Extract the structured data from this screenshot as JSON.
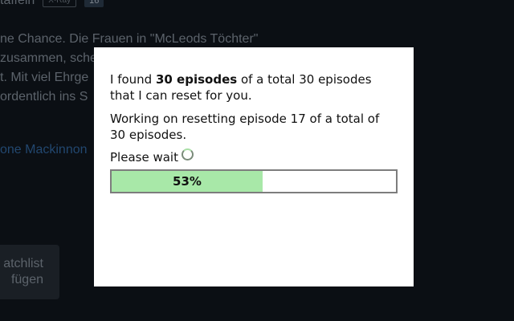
{
  "background": {
    "meta_text": "taffeln",
    "xray_badge": "X-Ray",
    "age_badge": "16",
    "description_lines": [
      "ne Chance. Die Frauen in \"McLeods Töchter\"",
      "zusammen, sche",
      "t. Mit viel Ehrge",
      "ordentlich ins S"
    ],
    "cast_link": "one Mackinnon",
    "watchlist_line1": "atchlist",
    "watchlist_line2": "fügen"
  },
  "modal": {
    "found_prefix": "I found ",
    "found_bold": "30 episodes",
    "found_suffix": " of a total 30 episodes that I can reset for you.",
    "working_text": "Working on resetting episode 17 of a total of 30 episodes.",
    "wait_text": "Please wait",
    "progress_label": "53%",
    "progress_fraction": 0.53,
    "colors": {
      "progress_fill": "#a8e8a8",
      "progress_border": "#7d7d7d"
    },
    "spinner_icon": "loading-spinner-icon"
  }
}
